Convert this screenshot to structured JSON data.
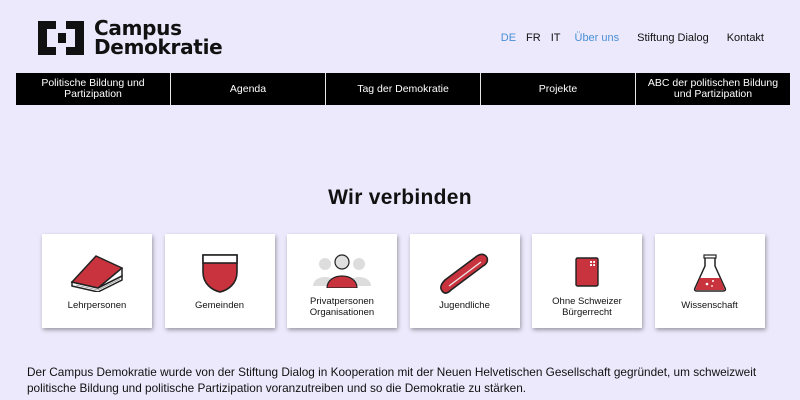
{
  "logo": {
    "line1": "Campus",
    "line2": "Demokratie"
  },
  "topnav": {
    "lang_de": "DE",
    "lang_fr": "FR",
    "lang_it": "IT",
    "about": "Über uns",
    "foundation": "Stiftung Dialog",
    "contact": "Kontakt"
  },
  "mainnav": [
    {
      "label": "Politische Bildung und Partizipation"
    },
    {
      "label": "Agenda"
    },
    {
      "label": "Tag der Demokratie"
    },
    {
      "label": "Projekte"
    },
    {
      "label": "ABC der politischen Bildung und Partizipation"
    }
  ],
  "section": {
    "title": "Wir verbinden"
  },
  "cards": [
    {
      "label": "Lehrpersonen",
      "icon": "book-icon"
    },
    {
      "label": "Gemeinden",
      "icon": "shield-icon"
    },
    {
      "label1": "Privatpersonen",
      "label2": "Organisationen",
      "icon": "people-icon"
    },
    {
      "label": "Jugendliche",
      "icon": "skateboard-icon"
    },
    {
      "label1": "Ohne Schweizer",
      "label2": "Bürgerrecht",
      "icon": "passport-icon"
    },
    {
      "label": "Wissenschaft",
      "icon": "flask-icon"
    }
  ],
  "colors": {
    "accent": "#c8333e",
    "background": "#ebe9fb",
    "active_link": "#4a8fd6"
  },
  "intro": {
    "text": "Der Campus Demokratie wurde von der Stiftung Dialog in Kooperation mit der Neuen Helvetischen Gesellschaft gegründet, um schweizweit politische Bildung und politische Partizipation voranzutreiben und so die Demokratie zu stärken."
  }
}
